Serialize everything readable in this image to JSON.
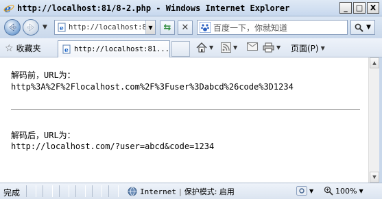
{
  "window": {
    "title": "http://localhost:81/8-2.php - Windows Internet Explorer",
    "min_label": "_",
    "max_label": "□",
    "close_label": "X"
  },
  "navbar": {
    "address": "http://localhost:8",
    "search_placeholder": "百度一下，你就知道",
    "refresh_glyph": "⇆",
    "stop_glyph": "✕",
    "search_btn_glyph": "🔍"
  },
  "favbar": {
    "favorites_label": "收藏夹",
    "tab_title": "http://localhost:81...",
    "page_menu_label": "页面(P)"
  },
  "content": {
    "before_label": "解码前，URL为：",
    "before_url": "http%3A%2F%2Flocalhost.com%2F%3Fuser%3Dabcd%26code%3D1234",
    "after_label": "解码后，URL为：",
    "after_url": "http://localhost.com/?user=abcd&code=1234"
  },
  "statusbar": {
    "status_text": "完成",
    "zone_name": "Internet",
    "separator": "|",
    "protected_mode": "保护模式: 启用",
    "zoom": "100%"
  }
}
